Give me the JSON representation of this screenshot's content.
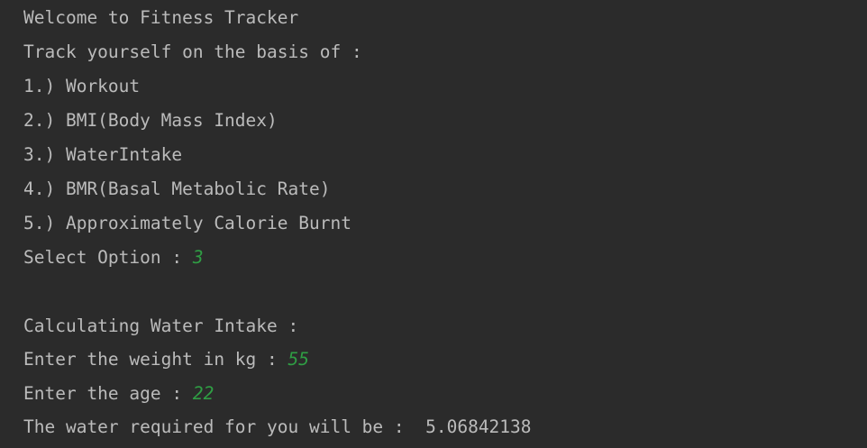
{
  "console": {
    "lines": [
      {
        "text": "Welcome to Fitness Tracker"
      },
      {
        "text": "Track yourself on the basis of :"
      },
      {
        "text": "1.) Workout"
      },
      {
        "text": "2.) BMI(Body Mass Index)"
      },
      {
        "text": "3.) WaterIntake"
      },
      {
        "text": "4.) BMR(Basal Metabolic Rate)"
      },
      {
        "text": "5.) Approximately Calorie Burnt"
      },
      {
        "text": "Select Option : ",
        "input": "3"
      },
      {
        "text": ""
      },
      {
        "text": "Calculating Water Intake :"
      },
      {
        "text": "Enter the weight in kg : ",
        "input": "55"
      },
      {
        "text": "Enter the age : ",
        "input": "22"
      },
      {
        "text": "The water required for you will be :  5.06842138"
      }
    ]
  },
  "colors": {
    "background": "#2b2b2b",
    "output_text": "#bbbbbb",
    "user_input": "#2f9e44"
  }
}
